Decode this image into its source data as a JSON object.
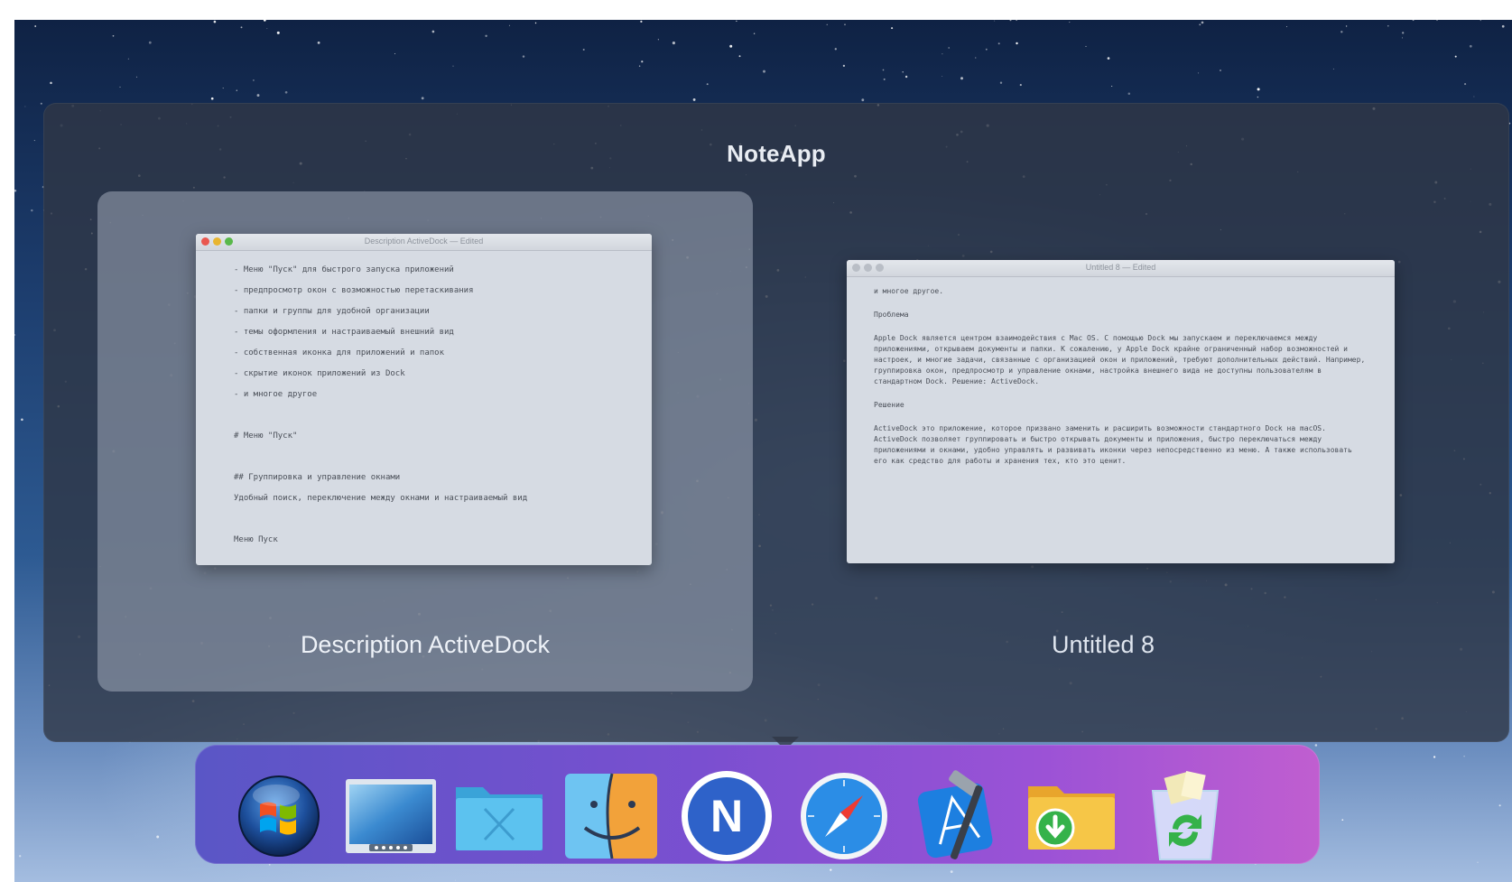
{
  "switcher": {
    "app_name": "NoteApp",
    "windows": [
      {
        "label": "Description ActiveDock",
        "selected": true,
        "preview_title": "Description ActiveDock — Edited",
        "preview_lines": [
          "- Меню \"Пуск\" для быстрого запуска приложений",
          "- предпросмотр окон с возможностью перетаскивания",
          "- папки и группы для удобной организации",
          "- темы оформления и настраиваемый внешний вид",
          "- собственная иконка для приложений и папок",
          "- скрытие иконок приложений из Dock",
          "- и многое другое",
          "",
          "# Меню \"Пуск\"",
          "",
          "## Группировка и управление окнами",
          "Удобный поиск, переключение между окнами и настраиваемый вид",
          "",
          "Меню Пуск"
        ]
      },
      {
        "label": "Untitled 8",
        "selected": false,
        "preview_title": "Untitled 8 — Edited",
        "preview_paragraphs": [
          "и многое другое.",
          "Проблема",
          "Apple Dock является центром взаимодействия с Mac OS. С помощью Dock мы запускаем и переключаемся между приложениями, открываем документы и папки. К сожалению, у Apple Dock крайне ограниченный набор возможностей и настроек, и многие задачи, связанные с организацией окон и приложений, требуют дополнительных действий. Например, группировка окон, предпросмотр и управление окнами, настройка внешнего вида не доступны пользователям в стандартном Dock. Решение: ActiveDock.",
          "Решение",
          "ActiveDock это приложение, которое призвано заменить и расширить возможности стандартного Dock на macOS. ActiveDock позволяет группировать и быстро открывать документы и приложения, быстро переключаться между приложениями и окнами, удобно управлять и развивать иконки через непосредственно из меню. А также использовать его как средство для работы и хранения тех, кто это ценит."
        ]
      }
    ]
  },
  "dock": {
    "items": [
      {
        "name": "start-menu",
        "icon": "windows-orb-icon",
        "active": false
      },
      {
        "name": "desktop-preview",
        "icon": "desktop-screen-icon",
        "active": false
      },
      {
        "name": "folder-x",
        "icon": "blue-folder-icon",
        "active": false
      },
      {
        "name": "finder",
        "icon": "finder-icon",
        "active": false
      },
      {
        "name": "noteapp",
        "icon": "noteapp-n-icon",
        "letter": "N",
        "active": true
      },
      {
        "name": "safari",
        "icon": "safari-compass-icon",
        "active": false
      },
      {
        "name": "xcode",
        "icon": "xcode-hammer-icon",
        "active": false
      },
      {
        "name": "downloads",
        "icon": "downloads-folder-icon",
        "active": false
      },
      {
        "name": "recycle-bin",
        "icon": "recycle-bin-icon",
        "active": false
      }
    ]
  },
  "colors": {
    "switcher_bg": "#303746",
    "selected_card": "#a0aab9",
    "dock_gradient_start": "#5a56c6",
    "dock_gradient_end": "#c05ed0",
    "noteapp_blue": "#2e62c9",
    "folder_blue": "#4fb6e6",
    "download_green": "#35b24a"
  }
}
